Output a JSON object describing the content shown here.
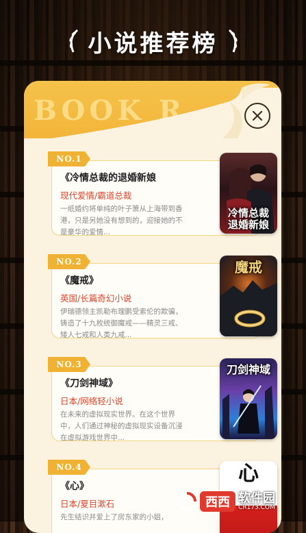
{
  "header": {
    "title": "小说推荐榜"
  },
  "panel": {
    "banner_text": "BOOK R"
  },
  "books": [
    {
      "rank": "NO.1",
      "title": "《冷情总裁的退婚新娘",
      "genre": "现代爱情/霸道总裁",
      "desc": "一纸婚约将单纯的叶子箫从上海带到香港，只是另她没有想到的，迎接她的不是豪华的爱情...",
      "cover_title": "冷情总裁\n退婚新娘"
    },
    {
      "rank": "NO.2",
      "title": "《魔戒》",
      "genre": "英国/长篇奇幻小说",
      "desc": "伊瑞德领主凯勒布理鹏受索伦的欺骗，铸造了十九枚统御魔戒——精灵三戒、矮人七戒和人类九戒...",
      "cover_title": "魔戒"
    },
    {
      "rank": "NO.3",
      "title": "《刀剑神域》",
      "genre": "日本/网络轻小说",
      "desc": "在未来的虚拟现实世界。在这个世界中，人们通过神秘的虚拟现实设备沉浸在虚拟游戏世界中...",
      "cover_title": "刀剑神域"
    },
    {
      "rank": "NO.4",
      "title": "《心》",
      "genre": "日本/夏目漱石",
      "desc": "先生结识并爱上了房东家的小姐，",
      "cover_title": "心"
    }
  ],
  "watermark": {
    "badge": "西西",
    "name": "软件园",
    "url": "CR173.COM"
  },
  "colors": {
    "accent": "#f3b53a",
    "genre": "#d9452c",
    "panel": "#fbf3df"
  }
}
